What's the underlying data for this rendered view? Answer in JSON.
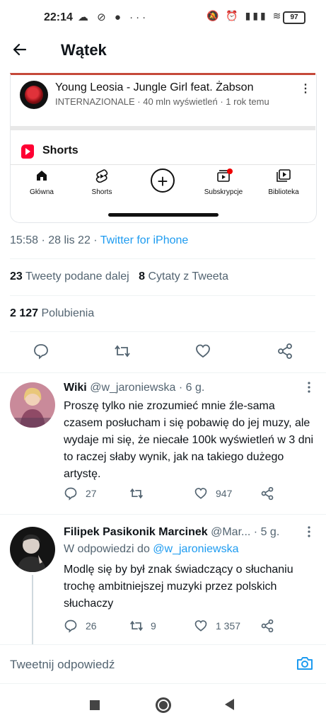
{
  "status_bar": {
    "time": "22:14",
    "left_icons": "☁ ⊘ ● ···",
    "right_icons": "🔕 ⏰ ▮▮▮ ≋",
    "battery": "97"
  },
  "header": {
    "title": "Wątek",
    "back_icon": "arrow-left-icon"
  },
  "embed": {
    "video_title": "Young Leosia - Jungle Girl feat. Żabson",
    "video_meta": "INTERNAZIONALE · 40 mln wyświetleń · 1 rok temu",
    "more": "⋮",
    "shorts_label": "Shorts",
    "nav": [
      {
        "label": "Główna",
        "icon": "⌂"
      },
      {
        "label": "Shorts",
        "icon": "ⓢ"
      },
      {
        "label": "Subskrypcje",
        "icon": "▤"
      },
      {
        "label": "Biblioteka",
        "icon": "▶"
      }
    ],
    "add_icon": "+"
  },
  "tweet": {
    "timestamp": "15:58 · 28 lis 22 · ",
    "source": "Twitter for iPhone",
    "retweets_count": "23",
    "retweets_label": "Tweety podane dalej",
    "quotes_count": "8",
    "quotes_label": "Cytaty z Tweeta",
    "likes_count": "2 127",
    "likes_label": "Polubienia"
  },
  "replies": [
    {
      "name": "Wiki",
      "handle": "@w_jaroniewska · 6 g.",
      "text": "Proszę tylko nie zrozumieć mnie źle-sama czasem posłucham i się pobawię do jej muzy, ale wydaje mi się, że niecałe 100k wyświetleń w 3 dni to raczej słaby wynik, jak na takiego dużego artystę.",
      "reply_count": "27",
      "retweet_count": "",
      "like_count": "947"
    },
    {
      "name": "Filipek Pasikonik Marcinek",
      "handle": "@Mar...",
      "time": "· 5 g.",
      "reply_to_prefix": "W odpowiedzi do ",
      "reply_to_mention": "@w_jaroniewska",
      "text": "Modlę się by był znak świadczący o słuchaniu trochę ambitniejszej muzyki przez polskich słuchaczy",
      "reply_count": "26",
      "retweet_count": "9",
      "like_count": "1 357"
    }
  ],
  "compose": {
    "placeholder": "Tweetnij odpowiedź"
  },
  "colors": {
    "accent": "#1d9bf0",
    "text": "#0f1419",
    "muted": "#536471",
    "youtube_red": "#ff0033"
  }
}
